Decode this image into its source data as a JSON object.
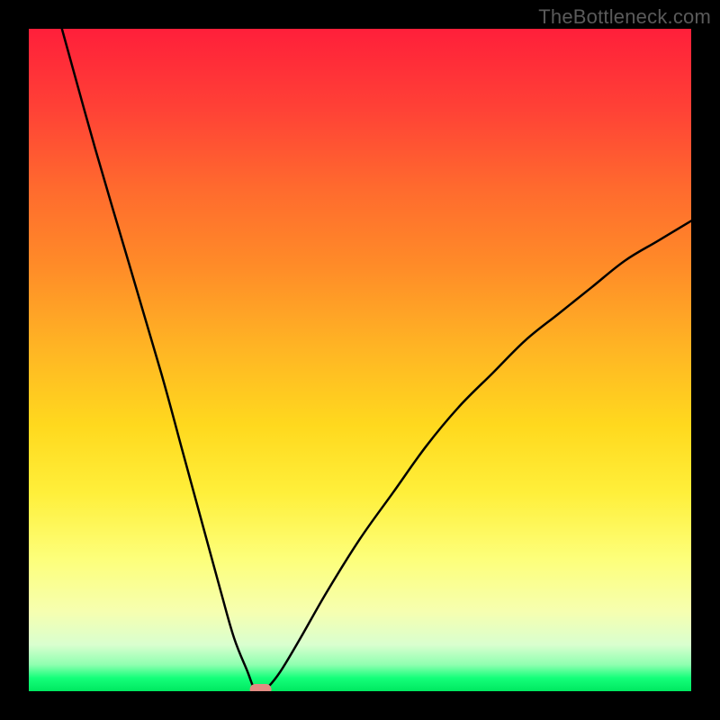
{
  "watermark": "TheBottleneck.com",
  "chart_data": {
    "type": "line",
    "title": "",
    "xlabel": "",
    "ylabel": "",
    "xlim": [
      0,
      100
    ],
    "ylim": [
      0,
      100
    ],
    "grid": false,
    "legend": false,
    "background": "rainbow-gradient (red top → green bottom)",
    "series": [
      {
        "name": "curve",
        "color": "#000000",
        "x": [
          5,
          10,
          15,
          20,
          23,
          26,
          29,
          31,
          33,
          34,
          35,
          36,
          38,
          41,
          45,
          50,
          55,
          60,
          65,
          70,
          75,
          80,
          85,
          90,
          95,
          100
        ],
        "values": [
          100,
          82,
          65,
          48,
          37,
          26,
          15,
          8,
          3,
          0.5,
          0,
          0.5,
          3,
          8,
          15,
          23,
          30,
          37,
          43,
          48,
          53,
          57,
          61,
          65,
          68,
          71
        ]
      }
    ],
    "marker": {
      "name": "bottleneck-point",
      "x": 35,
      "y": 0,
      "color": "#e28b83",
      "shape": "rounded-rect"
    }
  }
}
